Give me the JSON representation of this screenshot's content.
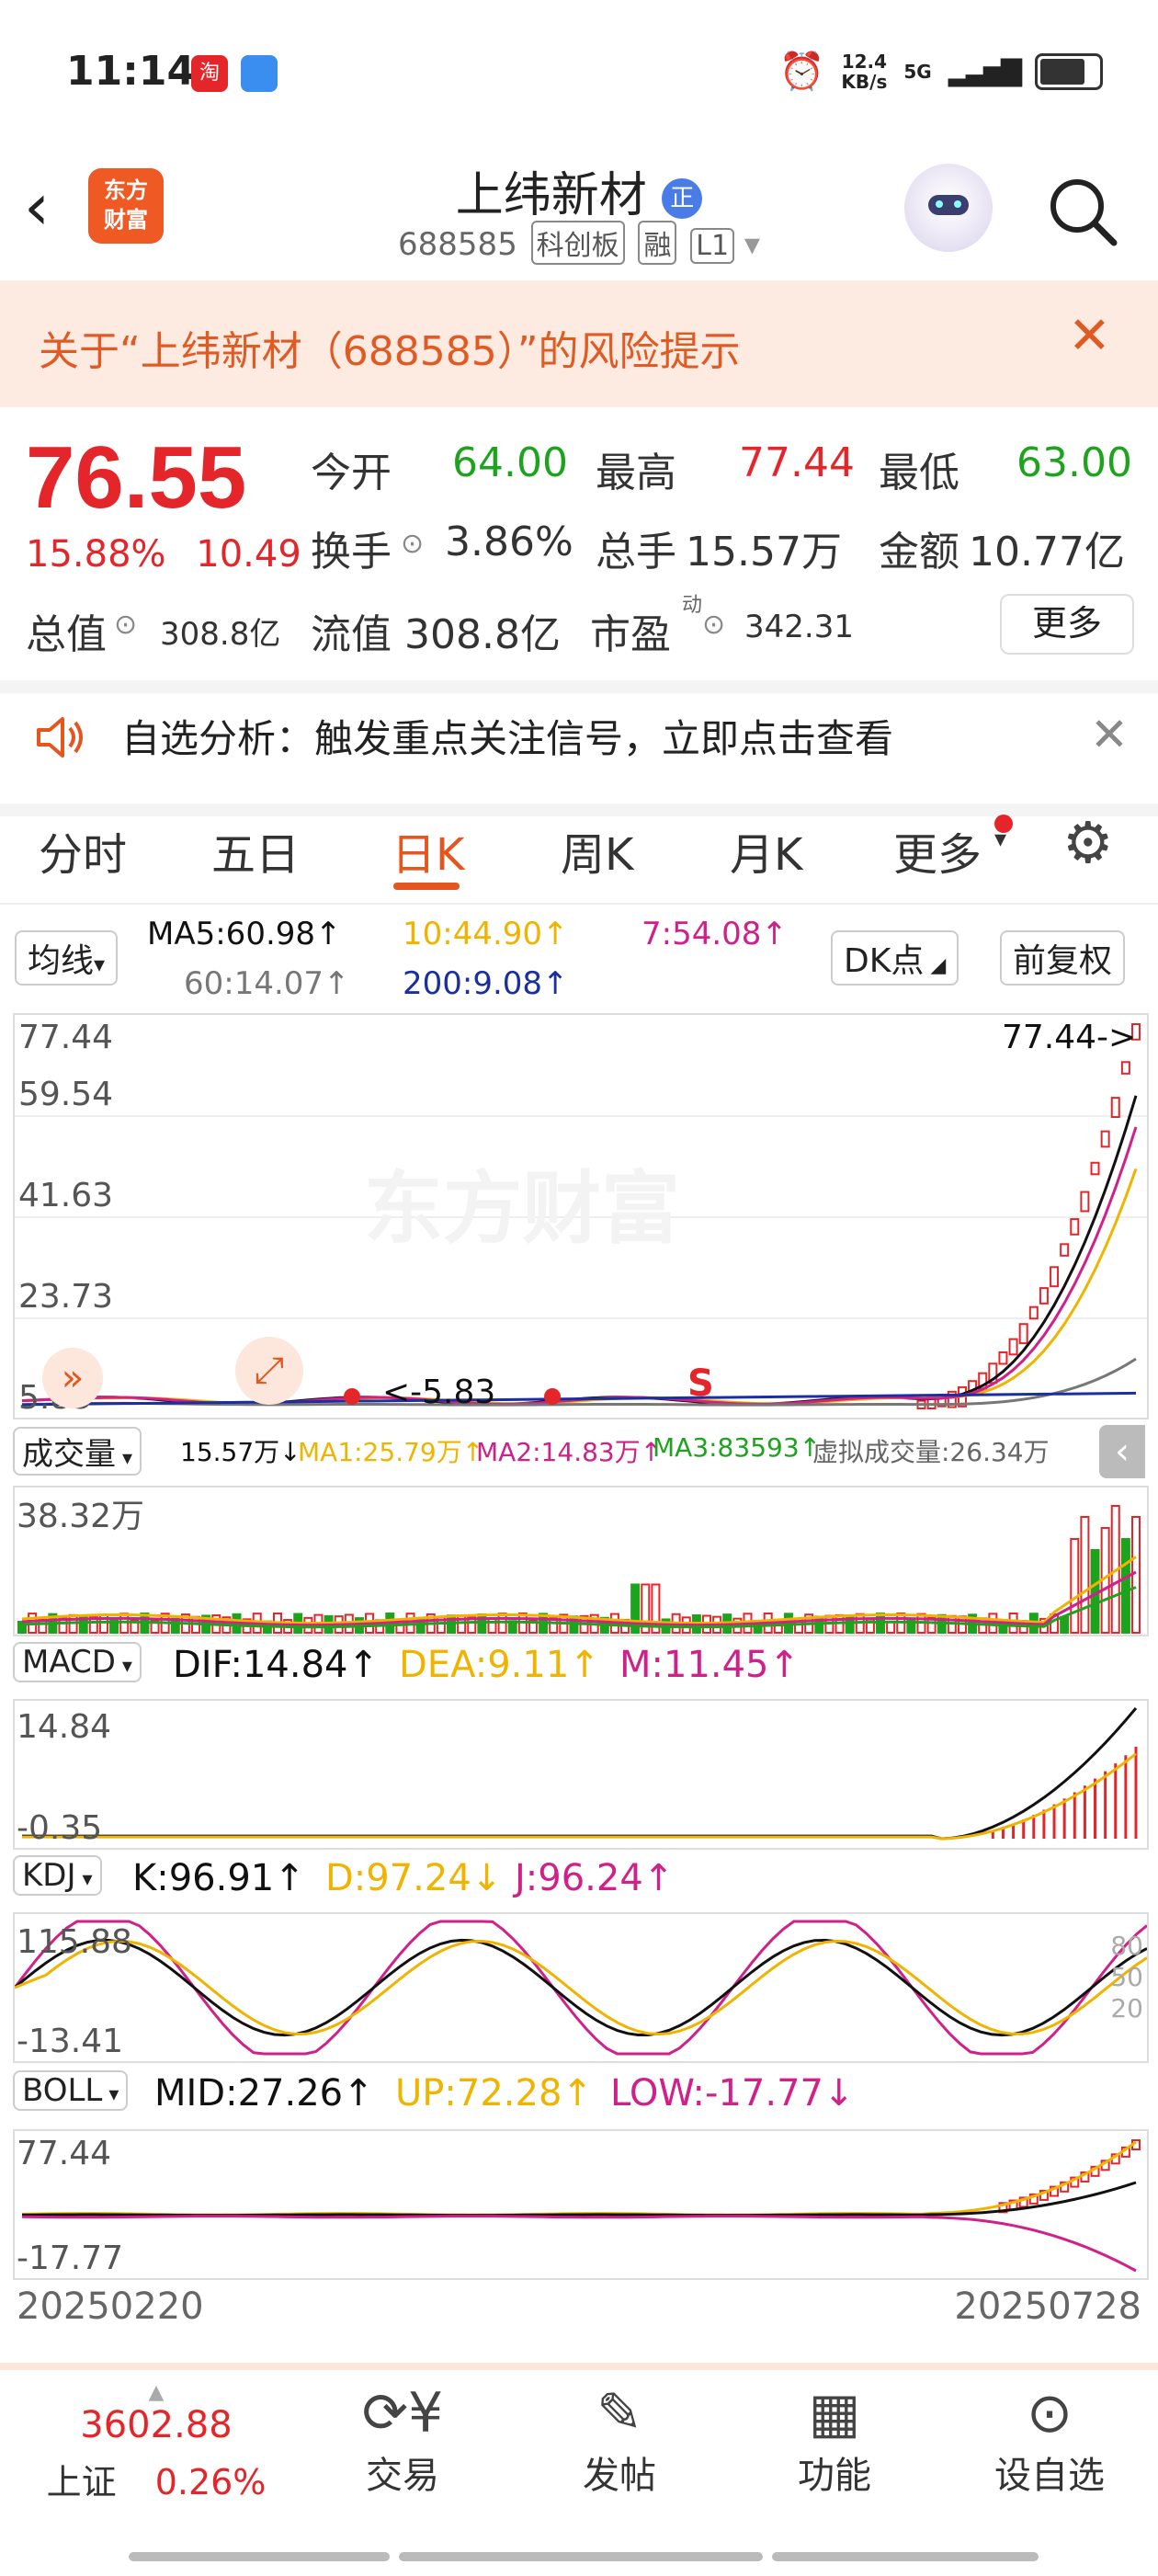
{
  "status_bar": {
    "time": "11:14",
    "net_speed": "12.4",
    "net_unit": "KB/s",
    "signal": "5G"
  },
  "header": {
    "title": "上纬新材",
    "badge": "正",
    "code": "688585",
    "tags": [
      "科创板",
      "融",
      "L1"
    ]
  },
  "risk_banner": {
    "text": "关于“上纬新材（688585）”的风险提示"
  },
  "quote": {
    "price": "76.55",
    "change_pct": "15.88%",
    "change_amt": "10.49",
    "open_label": "今开",
    "open": "64.00",
    "high_label": "最高",
    "high": "77.44",
    "low_label": "最低",
    "low": "63.00",
    "turnover_label": "换手",
    "turnover": "3.86%",
    "volume_label": "总手",
    "volume": "15.57万",
    "amount_label": "金额",
    "amount": "10.77亿",
    "mktcap_label": "总值",
    "mktcap": "308.8亿",
    "float_label": "流值",
    "float": "308.8亿",
    "pe_label": "市盈",
    "pe_sup": "动",
    "pe": "342.31",
    "more": "更多"
  },
  "analysis": {
    "text": "自选分析：触发重点关注信号，立即点击查看"
  },
  "tabs": [
    "分时",
    "五日",
    "日K",
    "周K",
    "月K",
    "更多"
  ],
  "kline": {
    "ma_select": "均线",
    "ma5": "MA5:60.98↑",
    "ma10": "10:44.90↑",
    "ma7": "7:54.08↑",
    "ma60": "60:14.07↑",
    "ma200": "200:9.08↑",
    "dk_button": "DK点",
    "adjust_button": "前复权",
    "y_labels": [
      "77.44",
      "59.54",
      "41.63",
      "23.73",
      "5.83"
    ],
    "high_marker": "77.44->",
    "low_marker": "<-5.83",
    "s_marker": "S",
    "watermark": "东方财富"
  },
  "volume": {
    "select": "成交量",
    "vol": "15.57万↓",
    "ma1": "MA1:25.79万↑",
    "ma2": "MA2:14.83万↑",
    "ma3": "MA3:83593↑",
    "virtual": "虚拟成交量:26.34万",
    "y_max": "38.32万"
  },
  "macd": {
    "select": "MACD",
    "dif": "DIF:14.84↑",
    "dea": "DEA:9.11↑",
    "m": "M:11.45↑",
    "y_max": "14.84",
    "y_min": "-0.35"
  },
  "kdj": {
    "select": "KDJ",
    "k": "K:96.91↑",
    "d": "D:97.24↓",
    "j": "J:96.24↑",
    "y_max": "115.88",
    "y_min": "-13.41",
    "levels": [
      "80",
      "50",
      "20"
    ]
  },
  "boll": {
    "select": "BOLL",
    "mid": "MID:27.26↑",
    "up": "UP:72.28↑",
    "low": "LOW:-17.77↓",
    "y_max": "77.44",
    "y_min": "-17.77"
  },
  "dates": {
    "start": "20250220",
    "end": "20250728"
  },
  "bottom_nav": {
    "index_value": "3602.88",
    "index_name": "上证",
    "index_change": "0.26%",
    "items": [
      {
        "label": "交易",
        "icon": "yen-exchange-icon"
      },
      {
        "label": "发帖",
        "icon": "edit-icon"
      },
      {
        "label": "功能",
        "icon": "grid-icon"
      },
      {
        "label": "设自选",
        "icon": "more-circle-icon"
      }
    ]
  },
  "colors": {
    "up": "#e4262b",
    "down": "#1ea31e",
    "accent": "#e4551f",
    "ma5": "#111111",
    "ma10": "#f0b400",
    "ma7": "#d0208a",
    "ma60": "#777777",
    "ma200": "#1a2fa0"
  }
}
